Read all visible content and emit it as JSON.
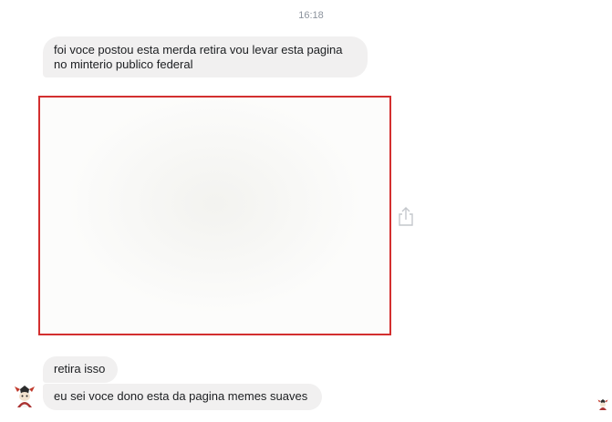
{
  "timestamp": "16:18",
  "messages": [
    {
      "line1": "foi voce postou esta merda retira vou levar esta pagina",
      "line2": "no minterio publico federal"
    },
    {
      "text": "retira isso"
    },
    {
      "text": "eu sei voce dono esta da pagina memes suaves"
    }
  ],
  "icons": {
    "share": "share-icon",
    "sender_avatar": "avatar-icon",
    "read_receipt": "read-receipt-avatar-icon"
  },
  "colors": {
    "bubble_bg": "#f1f0f0",
    "highlight_border": "#d32f2f",
    "timestamp": "#8d949e"
  }
}
